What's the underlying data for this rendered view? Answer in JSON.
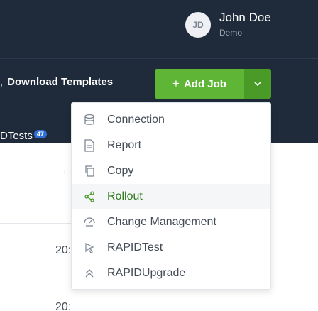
{
  "user": {
    "initials": "JD",
    "name": "John Doe",
    "role": "Demo"
  },
  "toolbar": {
    "breadcrumb_prefix": ",",
    "download_templates": "Download Templates",
    "add_job_plus": "+",
    "add_job_label": "Add Job",
    "caret": "⌄"
  },
  "tests": {
    "label": "DTests",
    "count": "47"
  },
  "table": {
    "column_header": "L",
    "row_values": [
      "20:",
      "20:"
    ]
  },
  "menu": {
    "items": [
      {
        "label": "Connection",
        "icon": "database-icon"
      },
      {
        "label": "Report",
        "icon": "report-icon"
      },
      {
        "label": "Copy",
        "icon": "copy-icon"
      },
      {
        "label": "Rollout",
        "icon": "share-icon",
        "active": true
      },
      {
        "label": "Change Management",
        "icon": "change-management-icon"
      },
      {
        "label": "RAPIDTest",
        "icon": "cursor-icon"
      },
      {
        "label": "RAPIDUpgrade",
        "icon": "double-chevron-up-icon"
      }
    ]
  },
  "colors": {
    "header_bg": "#1f2b3a",
    "accent_green": "#5fb536",
    "badge_blue": "#2f6fd6"
  }
}
